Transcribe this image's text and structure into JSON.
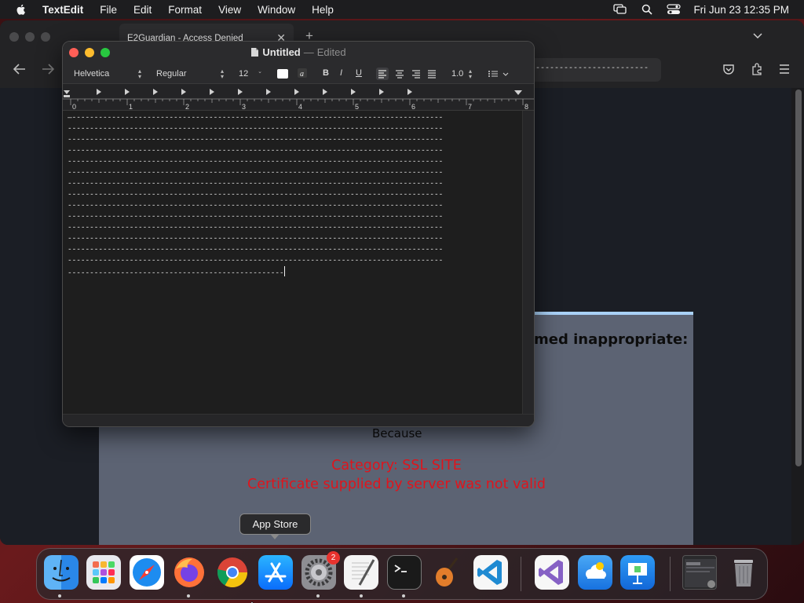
{
  "menubar": {
    "app_name": "TextEdit",
    "items": [
      "File",
      "Edit",
      "Format",
      "View",
      "Window",
      "Help"
    ],
    "clock": "Fri Jun 23  12:35 PM",
    "status_icons": [
      "screen-mirroring-icon",
      "search-icon",
      "control-center-icon"
    ]
  },
  "browser": {
    "tab_title": "E2Guardian - Access Denied",
    "url_text": "------------------------",
    "page": {
      "headline": "med inappropriate:",
      "because": "Because",
      "category": "Category: SSL SITE",
      "reason": "Certificate supplied by server was not valid"
    }
  },
  "textedit": {
    "doc_name": "Untitled",
    "doc_separator": "—",
    "doc_status": "Edited",
    "font_family": "Helvetica",
    "font_style": "Regular",
    "font_size": "12",
    "style_buttons": [
      "B",
      "I",
      "U"
    ],
    "line_spacing": "1.0",
    "ruler_numbers": [
      "0",
      "1",
      "2",
      "3",
      "4",
      "5",
      "6",
      "7",
      "8"
    ],
    "lines": [
      "—------------------------------------------------------------------------------------",
      "-------------------------------------------------------------------------------------",
      "-------------------------------------------------------------------------------------",
      "-------------------------------------------------------------------------------------",
      "-------------------------------------------------------------------------------------",
      "-------------------------------------------------------------------------------------",
      "-------------------------------------------------------------------------------------",
      "-------------------------------------------------------------------------------------",
      "-------------------------------------------------------------------------------------",
      "-------------------------------------------------------------------------------------",
      "-------------------------------------------------------------------------------------",
      "-------------------------------------------------------------------------------------",
      "-------------------------------------------------------------------------------------",
      "-------------------------------------------------------------------------------------",
      "-------------------------------------------------"
    ]
  },
  "dock": {
    "tooltip": "App Store",
    "settings_badge": "2",
    "apps": [
      "Finder",
      "Launchpad",
      "Safari",
      "Firefox",
      "Google Chrome",
      "App Store",
      "System Settings",
      "TextEdit",
      "Terminal",
      "GarageBand",
      "Visual Studio Code",
      "Visual Studio",
      "iCloud",
      "Keynote",
      "Window Preview",
      "Trash"
    ]
  },
  "colors": {
    "accent_red": "#e0141c",
    "panel": "#5c6373",
    "panel_border": "#a9d1f7",
    "badge": "#e8322e"
  }
}
